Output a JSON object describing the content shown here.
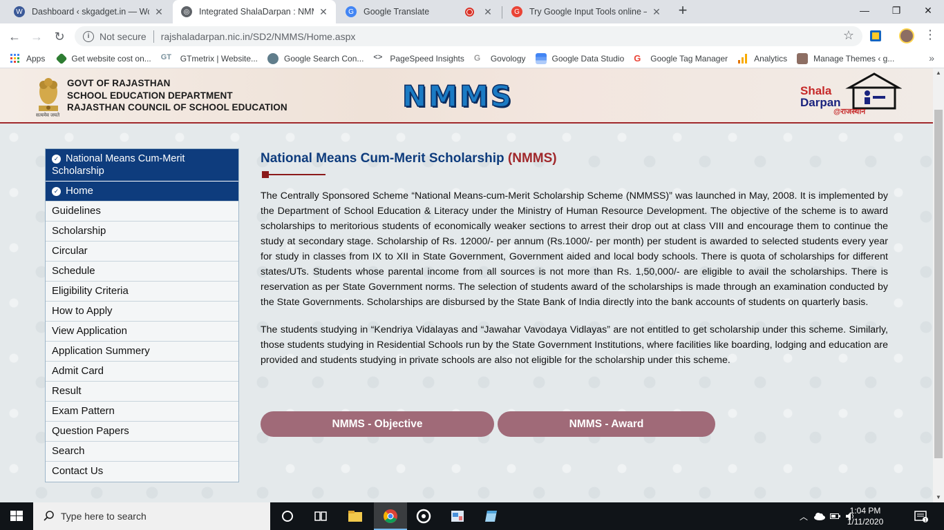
{
  "browser": {
    "tabs": [
      {
        "title": "Dashboard ‹ skgadget.in — Word",
        "icon": "wordpress-icon",
        "color": "#3b5998"
      },
      {
        "title": "Integrated ShalaDarpan : NMMS",
        "icon": "globe-icon",
        "color": "#5f6368"
      },
      {
        "title": "Google Translate",
        "icon": "google-translate-icon",
        "color": "#4285f4"
      },
      {
        "title": "Try Google Input Tools online – G",
        "icon": "google-icon",
        "color": "#ea4335"
      }
    ],
    "new_tab": "+",
    "not_secure": "Not secure",
    "url": "rajshaladarpan.nic.in/SD2/NMMS/Home.aspx",
    "bookmarks": [
      {
        "label": "Apps",
        "icon": "apps-grid-icon",
        "color": "#4285f4"
      },
      {
        "label": "Get website cost on...",
        "icon": "tag-icon",
        "color": "#2e7d32"
      },
      {
        "label": "GTmetrix | Website...",
        "icon": "gtmetrix-icon",
        "color": "#78909c"
      },
      {
        "label": "Google Search Con...",
        "icon": "search-console-icon",
        "color": "#607d8b"
      },
      {
        "label": "PageSpeed Insights",
        "icon": "code-icon",
        "color": "#5f6368"
      },
      {
        "label": "Govology",
        "icon": "g-icon",
        "color": "#9e9e9e"
      },
      {
        "label": "Google Data Studio",
        "icon": "data-studio-icon",
        "color": "#4285f4"
      },
      {
        "label": "Google Tag Manager",
        "icon": "google-icon",
        "color": "#ea4335"
      },
      {
        "label": "Analytics",
        "icon": "analytics-icon",
        "color": "#f9ab00"
      },
      {
        "label": "Manage Themes ‹ g...",
        "icon": "avatar-icon",
        "color": "#8d6e63"
      }
    ]
  },
  "header": {
    "govt_line1": "GOVT OF RAJASTHAN",
    "govt_line2": "SCHOOL EDUCATION DEPARTMENT",
    "govt_line3": "RAJASTHAN COUNCIL OF SCHOOL EDUCATION",
    "emblem_caption": "सत्यमेव जयते",
    "nmms_logo": "NMMS",
    "sd_shala": "Shala",
    "sd_darpan": "Darpan",
    "sd_rajasthan": "@राजस्थान"
  },
  "sidebar": {
    "heading": "National Means Cum-Merit Scholarship",
    "active": "Home",
    "items": [
      "Guidelines",
      "Scholarship",
      "Circular",
      "Schedule",
      "Eligibility Criteria",
      "How to Apply",
      "View Application",
      "Application Summery",
      "Admit Card",
      "Result",
      "Exam Pattern",
      "Question Papers",
      "Search",
      "Contact Us"
    ]
  },
  "content": {
    "title": "National Means Cum-Merit Scholarship",
    "title_acronym": "(NMMS)",
    "para1": "The Centrally Sponsored Scheme “National Means-cum-Merit Scholarship Scheme (NMMSS)” was launched in May, 2008. It is implemented by the Department of School Education & Literacy under the Ministry of Human Resource Development. The objective of the scheme is to award scholarships to meritorious students of economically weaker sections to arrest their drop out at class VIII and encourage them to continue the study at secondary stage. Scholarship of Rs. 12000/- per annum (Rs.1000/- per month) per student is awarded to selected students every year for study in classes from IX to XII in State Government, Government aided and local body schools. There is quota of scholarships for different states/UTs. Students whose parental income from all sources is not more than Rs. 1,50,000/- are eligible to avail the scholarships. There is reservation as per State Government norms. The selection of students award of the scholarships is made through an examination conducted by the State Governments. Scholarships are disbursed by the State Bank of India directly into the bank accounts of students on quarterly basis.",
    "para2": "The students studying in “Kendriya Vidalayas and “Jawahar Vavodaya Vidlayas” are not entitled to get scholarship under this scheme. Similarly, those students studying in Residential Schools run by the State Government Institutions, where facilities like boarding, lodging and education are provided and students studying in private schools are also not eligible for the scholarship under this scheme.",
    "btn_objective": "NMMS - Objective",
    "btn_award": "NMMS - Award"
  },
  "taskbar": {
    "search_placeholder": "Type here to search",
    "time": "1:04 PM",
    "date": "1/11/2020"
  },
  "colors": {
    "navy": "#0e3c7d",
    "maroon": "#a0282b",
    "pill": "#a06a78"
  }
}
